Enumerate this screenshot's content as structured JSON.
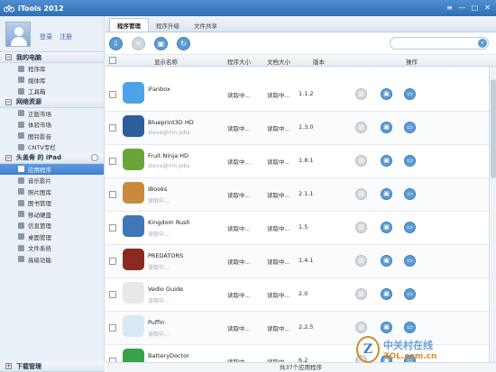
{
  "app": {
    "title": "iTools 2012"
  },
  "window_buttons": [
    "≡",
    "—",
    "□",
    "✕"
  ],
  "profile": {
    "login": "登录",
    "register": "注册"
  },
  "sidebar": {
    "sections": [
      {
        "label": "我的电脑",
        "items": [
          {
            "label": "程序库",
            "icon": "apps-icon"
          },
          {
            "label": "媒体库",
            "icon": "media-icon"
          },
          {
            "label": "工具箱",
            "icon": "toolbox-icon"
          }
        ]
      },
      {
        "label": "网络资源",
        "items": [
          {
            "label": "正版市场",
            "icon": "market-icon"
          },
          {
            "label": "体验市场",
            "icon": "trial-market-icon"
          },
          {
            "label": "图铃影音",
            "icon": "music-icon"
          },
          {
            "label": "CNTV专栏",
            "icon": "tv-icon"
          }
        ]
      },
      {
        "label": "头盖骨 的 iPad",
        "items": [
          {
            "label": "应用程序",
            "icon": "grid-icon",
            "active": true
          },
          {
            "label": "音乐影片",
            "icon": "music-film-icon"
          },
          {
            "label": "照片图库",
            "icon": "photo-icon"
          },
          {
            "label": "图书管理",
            "icon": "book-icon"
          },
          {
            "label": "移动硬盘",
            "icon": "disk-icon"
          },
          {
            "label": "信息管理",
            "icon": "info-icon"
          },
          {
            "label": "桌面管理",
            "icon": "desktop-icon"
          },
          {
            "label": "文件系统",
            "icon": "filesystem-icon"
          },
          {
            "label": "高级功能",
            "icon": "advanced-icon"
          }
        ]
      }
    ],
    "bottom": "下载管理"
  },
  "tabs": [
    "程序管理",
    "程序升级",
    "文件共享"
  ],
  "table": {
    "headers": {
      "name": "显示名称",
      "size": "程序大小",
      "doc": "文档大小",
      "version": "版本",
      "actions": "操作"
    },
    "rows": [
      {
        "name": "iFanbox",
        "sub": "",
        "size": "读取中...",
        "doc": "读取中...",
        "version": "1.1.2",
        "color": "#4da3e8"
      },
      {
        "name": "Blueprint3D HD",
        "sub": "steve@rim.jobs",
        "size": "读取中...",
        "doc": "读取中...",
        "version": "1.3.0",
        "color": "#2c5e9a"
      },
      {
        "name": "Fruit Ninja HD",
        "sub": "steve@rim.jobs",
        "size": "读取中...",
        "doc": "读取中...",
        "version": "1.8.1",
        "color": "#6aa53a"
      },
      {
        "name": "iBooks",
        "sub": "读取中...",
        "size": "读取中...",
        "doc": "读取中...",
        "version": "2.1.1",
        "color": "#c98a3c"
      },
      {
        "name": "Kingdom Rush",
        "sub": "读取中...",
        "size": "读取中...",
        "doc": "读取中...",
        "version": "1.5",
        "color": "#3f78b8"
      },
      {
        "name": "PREDATORS",
        "sub": "读取中...",
        "size": "读取中...",
        "doc": "读取中...",
        "version": "1.4.1",
        "color": "#8a2a20"
      },
      {
        "name": "Vedio Guide",
        "sub": "读取中...",
        "size": "读取中...",
        "doc": "读取中...",
        "version": "2.0",
        "color": "#e8e8e8"
      },
      {
        "name": "Puffin",
        "sub": "读取中...",
        "size": "读取中...",
        "doc": "读取中...",
        "version": "2.2.5",
        "color": "#d9e8f5"
      },
      {
        "name": "BatteryDoctor",
        "sub": "读取中...",
        "size": "读取中...",
        "doc": "读取中...",
        "version": "6.2",
        "color": "#3aa04a"
      }
    ]
  },
  "status": "共37个应用程序",
  "watermark": {
    "mark": "Z",
    "cn": "中关村在线",
    "url": "ZOL.com.cn"
  }
}
